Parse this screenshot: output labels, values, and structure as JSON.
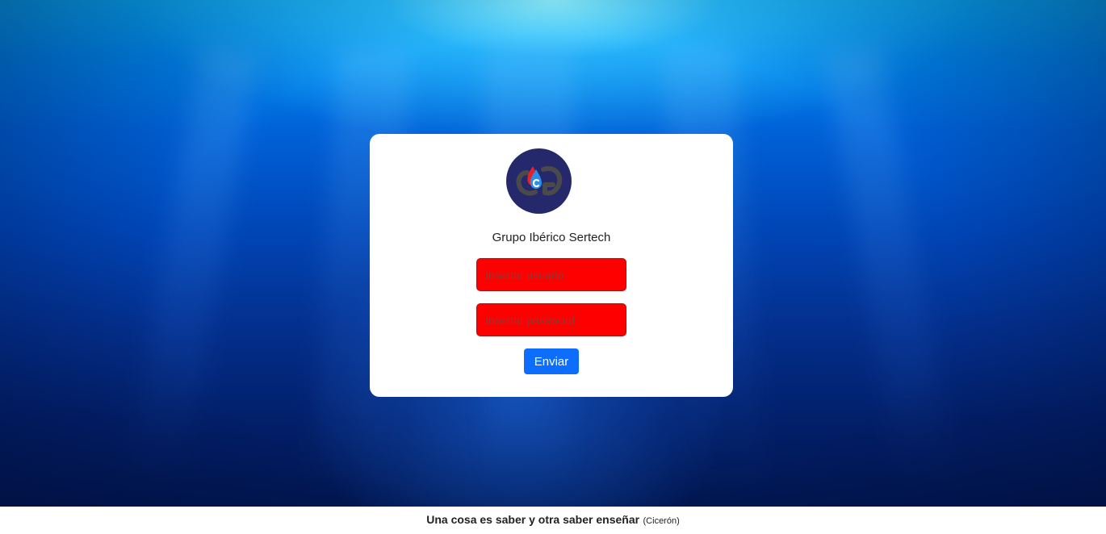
{
  "login": {
    "company_name": "Grupo Ibérico Sertech",
    "username_placeholder": "Insertar usuario",
    "password_placeholder": "Insertar password",
    "submit_label": "Enviar"
  },
  "footer": {
    "quote": "Una cosa es saber y otra saber enseñar",
    "author": "(Cicerón)"
  },
  "colors": {
    "input_background": "#ff0000",
    "button_background": "#0d6efd",
    "logo_background": "#25296b"
  },
  "icons": {
    "logo": "gs-water-drop-logo-icon"
  }
}
